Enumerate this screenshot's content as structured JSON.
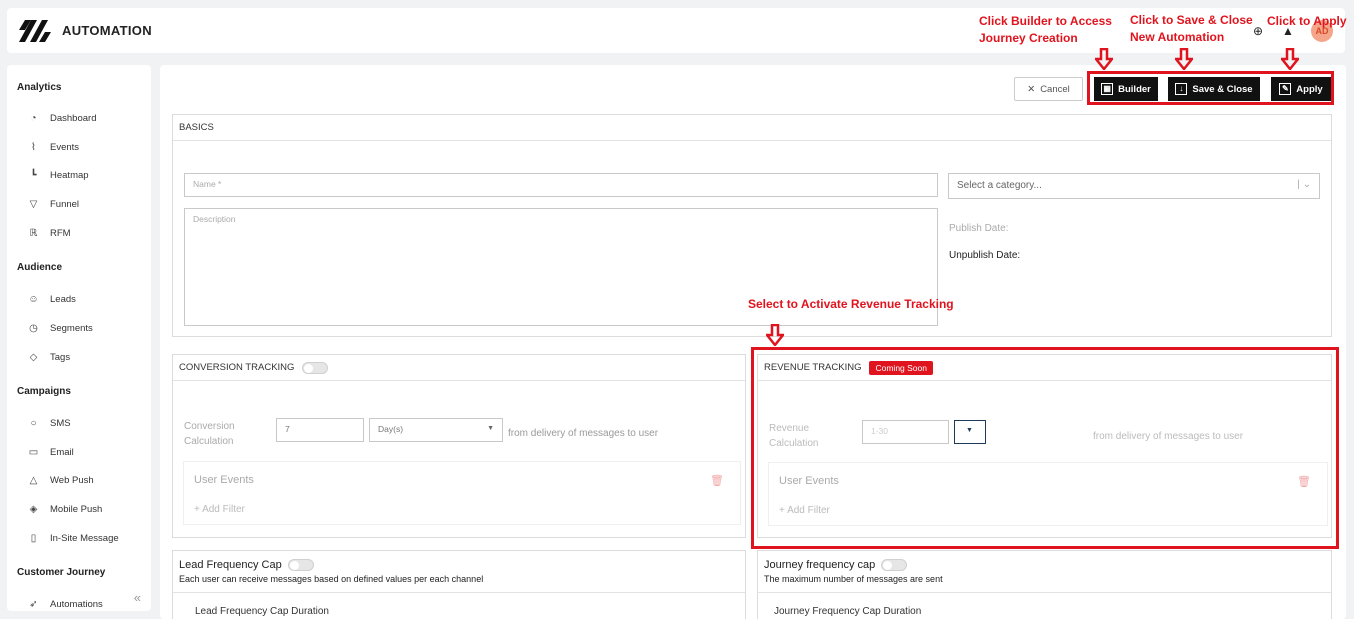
{
  "app": {
    "title": "AUTOMATION",
    "avatar_initials": "AD"
  },
  "icons": {
    "logo": "stripes-logo-icon",
    "support": "lifebuoy-icon",
    "notifications": "bell-icon"
  },
  "sidebar": {
    "sections": [
      {
        "label": "Analytics",
        "items": [
          {
            "label": "Dashboard",
            "icon": "gauge-icon"
          },
          {
            "label": "Events",
            "icon": "line-chart-icon"
          },
          {
            "label": "Heatmap",
            "icon": "bar-chart-icon"
          },
          {
            "label": "Funnel",
            "icon": "funnel-icon"
          },
          {
            "label": "RFM",
            "icon": "r-box-icon"
          }
        ]
      },
      {
        "label": "Audience",
        "items": [
          {
            "label": "Leads",
            "icon": "users-icon"
          },
          {
            "label": "Segments",
            "icon": "pie-icon"
          },
          {
            "label": "Tags",
            "icon": "tag-icon"
          }
        ]
      },
      {
        "label": "Campaigns",
        "items": [
          {
            "label": "SMS",
            "icon": "chat-icon"
          },
          {
            "label": "Email",
            "icon": "mail-icon"
          },
          {
            "label": "Web Push",
            "icon": "bell-icon"
          },
          {
            "label": "Mobile Push",
            "icon": "mobile-icon"
          },
          {
            "label": "In-Site Message",
            "icon": "page-icon"
          }
        ]
      },
      {
        "label": "Customer Journey",
        "items": [
          {
            "label": "Automations",
            "icon": "rocket-icon"
          }
        ]
      }
    ]
  },
  "toolbar": {
    "cancel": "Cancel",
    "builder": "Builder",
    "save_close": "Save & Close",
    "apply": "Apply"
  },
  "basics": {
    "title": "BASICS",
    "name_placeholder": "Name *",
    "description_placeholder": "Description",
    "category_placeholder": "Select a category...",
    "publish_date_label": "Publish Date:",
    "unpublish_date_label": "Unpublish Date:"
  },
  "conversion": {
    "title": "CONVERSION TRACKING",
    "calc_label_1": "Conversion",
    "calc_label_2": "Calculation",
    "value": "7",
    "unit": "Day(s)",
    "suffix": "from delivery of messages to user",
    "events_title": "User Events",
    "add_filter": "+ Add Filter"
  },
  "revenue": {
    "title": "REVENUE TRACKING",
    "badge": "Coming Soon",
    "calc_label_1": "Revenue",
    "calc_label_2": "Calculation",
    "placeholder": "1-30",
    "suffix": "from delivery of messages to user",
    "events_title": "User Events",
    "add_filter": "+ Add Filter"
  },
  "lead_cap": {
    "title": "Lead Frequency Cap",
    "desc": "Each user can receive messages based on defined values per each channel",
    "sub": "Lead Frequency Cap Duration"
  },
  "journey_cap": {
    "title": "Journey frequency cap",
    "desc": "The maximum number of messages are sent",
    "sub": "Journey Frequency Cap Duration"
  },
  "annotations": {
    "builder_1": "Click Builder to Access",
    "builder_2": "Journey Creation",
    "save_1": "Click to Save & Close",
    "save_2": "New Automation",
    "apply": "Click to Apply",
    "revenue": "Select to Activate Revenue Tracking"
  },
  "colors": {
    "annotation": "#e0141e",
    "dark_button": "#111111"
  }
}
